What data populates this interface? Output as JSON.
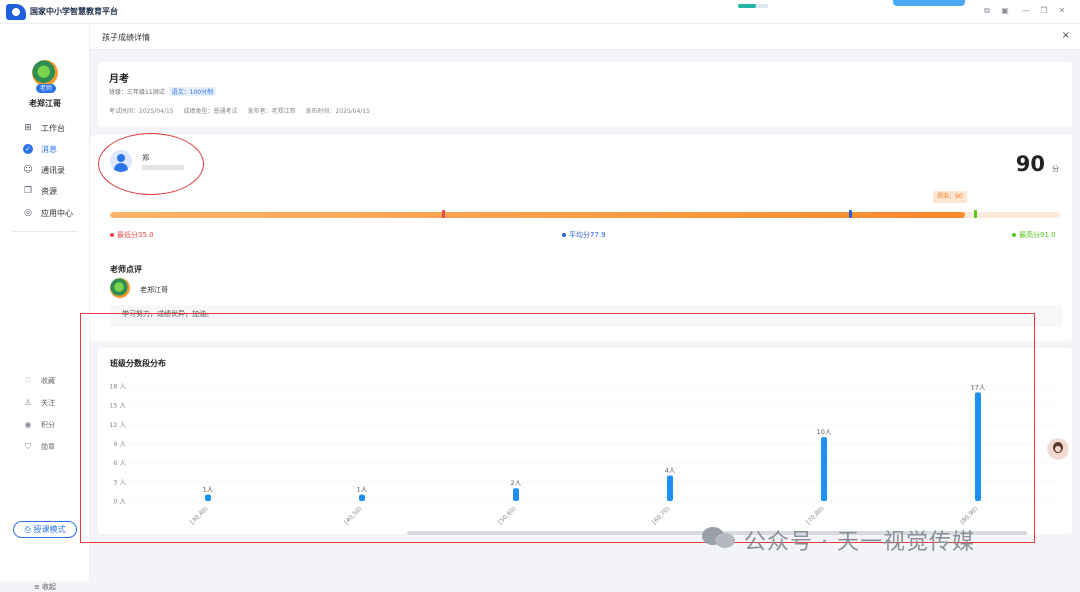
{
  "app": {
    "title": "国家中小学智慧教育平台"
  },
  "sidebar": {
    "user_badge": "老师",
    "user_name": "老郑江哥",
    "items": [
      {
        "label": "工作台",
        "icon": "workbench-icon"
      },
      {
        "label": "消息",
        "icon": "message-icon",
        "active": true
      },
      {
        "label": "通讯录",
        "icon": "contacts-icon"
      },
      {
        "label": "资源",
        "icon": "resources-icon"
      },
      {
        "label": "应用中心",
        "icon": "app-center-icon"
      }
    ],
    "secondary": [
      {
        "label": "收藏",
        "icon": "heart-icon"
      },
      {
        "label": "关注",
        "icon": "follow-icon"
      },
      {
        "label": "积分",
        "icon": "points-icon"
      },
      {
        "label": "勋章",
        "icon": "medal-icon"
      }
    ],
    "mode_button": "授课模式",
    "collapse_label": "收起"
  },
  "page": {
    "title": "孩子成绩详情"
  },
  "exam": {
    "name": "月考",
    "class_label": "班级：",
    "class_value": "三年级11测试",
    "subject_tag": "语文：100分制",
    "exam_time": "考试时间：2025/04/15",
    "score_type": "成绩类型：普通考试",
    "publisher": "发布者：老郑江哥",
    "publish_time": "发布时间：2025/04/15"
  },
  "student": {
    "name": "郑",
    "score": "90",
    "score_unit": "分",
    "tooltip": "郑浩：90",
    "score_fraction": 0.9,
    "min_fraction": 0.35,
    "avg_fraction": 0.779,
    "max_fraction": 0.91,
    "min_label": "最低分35.0",
    "avg_label": "平均分77.9",
    "max_label": "最高分91.0",
    "min_color": "#e84a4a",
    "avg_color": "#2a5fd6",
    "max_color": "#52c41a"
  },
  "teacher_comment": {
    "title": "老师点评",
    "teacher": "老郑江哥",
    "text": "学习努力，成绩优异，加油。"
  },
  "chart_data": {
    "type": "bar",
    "title": "班级分数段分布",
    "categories": [
      "[30,40)",
      "[40,50)",
      "[50,60)",
      "[60,70)",
      "[70,80)",
      "[80,90)"
    ],
    "values": [
      1,
      1,
      2,
      4,
      10,
      17
    ],
    "value_labels": [
      "1人",
      "1人",
      "2人",
      "4人",
      "10人",
      "17人"
    ],
    "yticks": [
      "0 人",
      "3 人",
      "6 人",
      "9 人",
      "12 人",
      "15 人",
      "18 人"
    ],
    "ylim": [
      0,
      18
    ],
    "color": "#1e90f0"
  },
  "watermark": {
    "text": "公众号 · 天一视觉传媒"
  }
}
